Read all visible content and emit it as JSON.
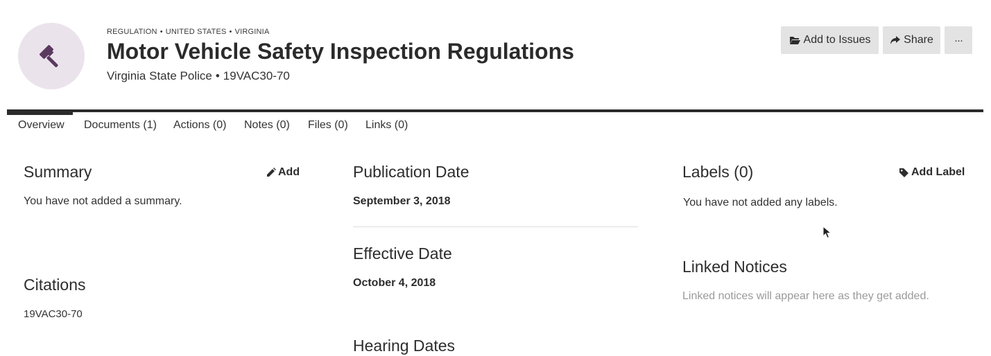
{
  "header": {
    "breadcrumb": [
      "REGULATION",
      "UNITED STATES",
      "VIRGINIA"
    ],
    "title": "Motor Vehicle Safety Inspection Regulations",
    "agency": "Virginia State Police",
    "code": "19VAC30-70",
    "avatar_icon": "gavel-icon",
    "avatar_color": "#5b3a5f"
  },
  "actions": {
    "add_to_issues": "Add to Issues",
    "share": "Share",
    "more": "···"
  },
  "tabs": [
    {
      "label": "Overview",
      "active": true
    },
    {
      "label": "Documents (1)",
      "active": false
    },
    {
      "label": "Actions (0)",
      "active": false
    },
    {
      "label": "Notes (0)",
      "active": false
    },
    {
      "label": "Files (0)",
      "active": false
    },
    {
      "label": "Links (0)",
      "active": false
    }
  ],
  "summary": {
    "heading": "Summary",
    "add_label": "Add",
    "text": "You have not added a summary."
  },
  "citations": {
    "heading": "Citations",
    "items": [
      "19VAC30-70"
    ]
  },
  "publication": {
    "heading": "Publication Date",
    "date": "September 3, 2018"
  },
  "effective": {
    "heading": "Effective Date",
    "date": "October 4, 2018"
  },
  "hearing": {
    "heading": "Hearing Dates"
  },
  "labels": {
    "heading": "Labels (0)",
    "add_label": "Add Label",
    "empty_text": "You have not added any labels."
  },
  "linked_notices": {
    "heading": "Linked Notices",
    "empty_text": "Linked notices will appear here as they get added."
  }
}
